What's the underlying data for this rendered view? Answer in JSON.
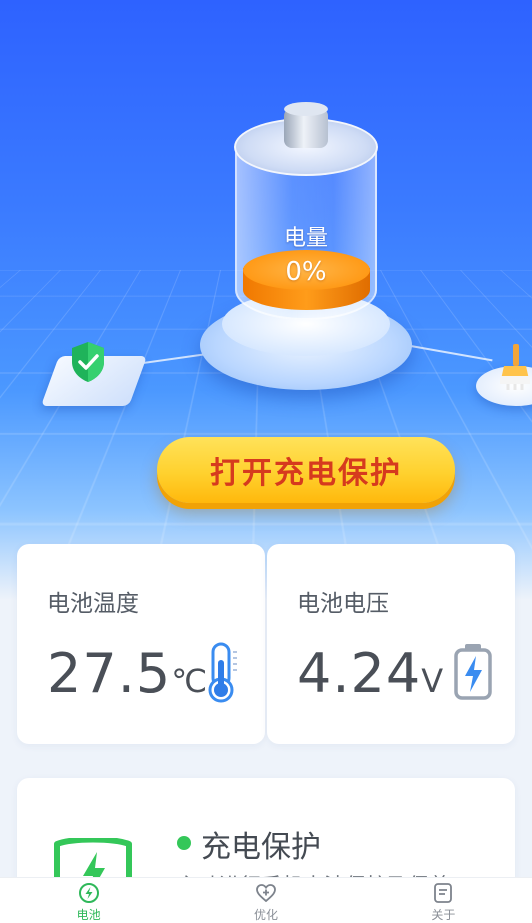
{
  "hero": {
    "charge_label": "电量",
    "charge_value": "0%",
    "protect_button": "打开充电保护"
  },
  "cards": {
    "temperature": {
      "title": "电池温度",
      "value": "27.5",
      "unit": "℃",
      "icon": "thermometer-icon"
    },
    "voltage": {
      "title": "电池电压",
      "value": "4.24",
      "unit": "V",
      "icon": "battery-bolt-icon"
    }
  },
  "protection": {
    "title": "充电保护",
    "description": "主动进行手机电池保护及保养",
    "icon": "shield-bolt-icon",
    "status_color": "#34c759"
  },
  "bottom_nav": {
    "items": [
      {
        "label": "电池",
        "icon": "bolt-circle-icon",
        "active": true
      },
      {
        "label": "优化",
        "icon": "heart-plus-icon",
        "active": false
      },
      {
        "label": "关于",
        "icon": "document-icon",
        "active": false
      }
    ]
  },
  "colors": {
    "accent_green": "#2fb85a",
    "button_text": "#d63a1e",
    "battery_fill": "#ff9a17"
  }
}
